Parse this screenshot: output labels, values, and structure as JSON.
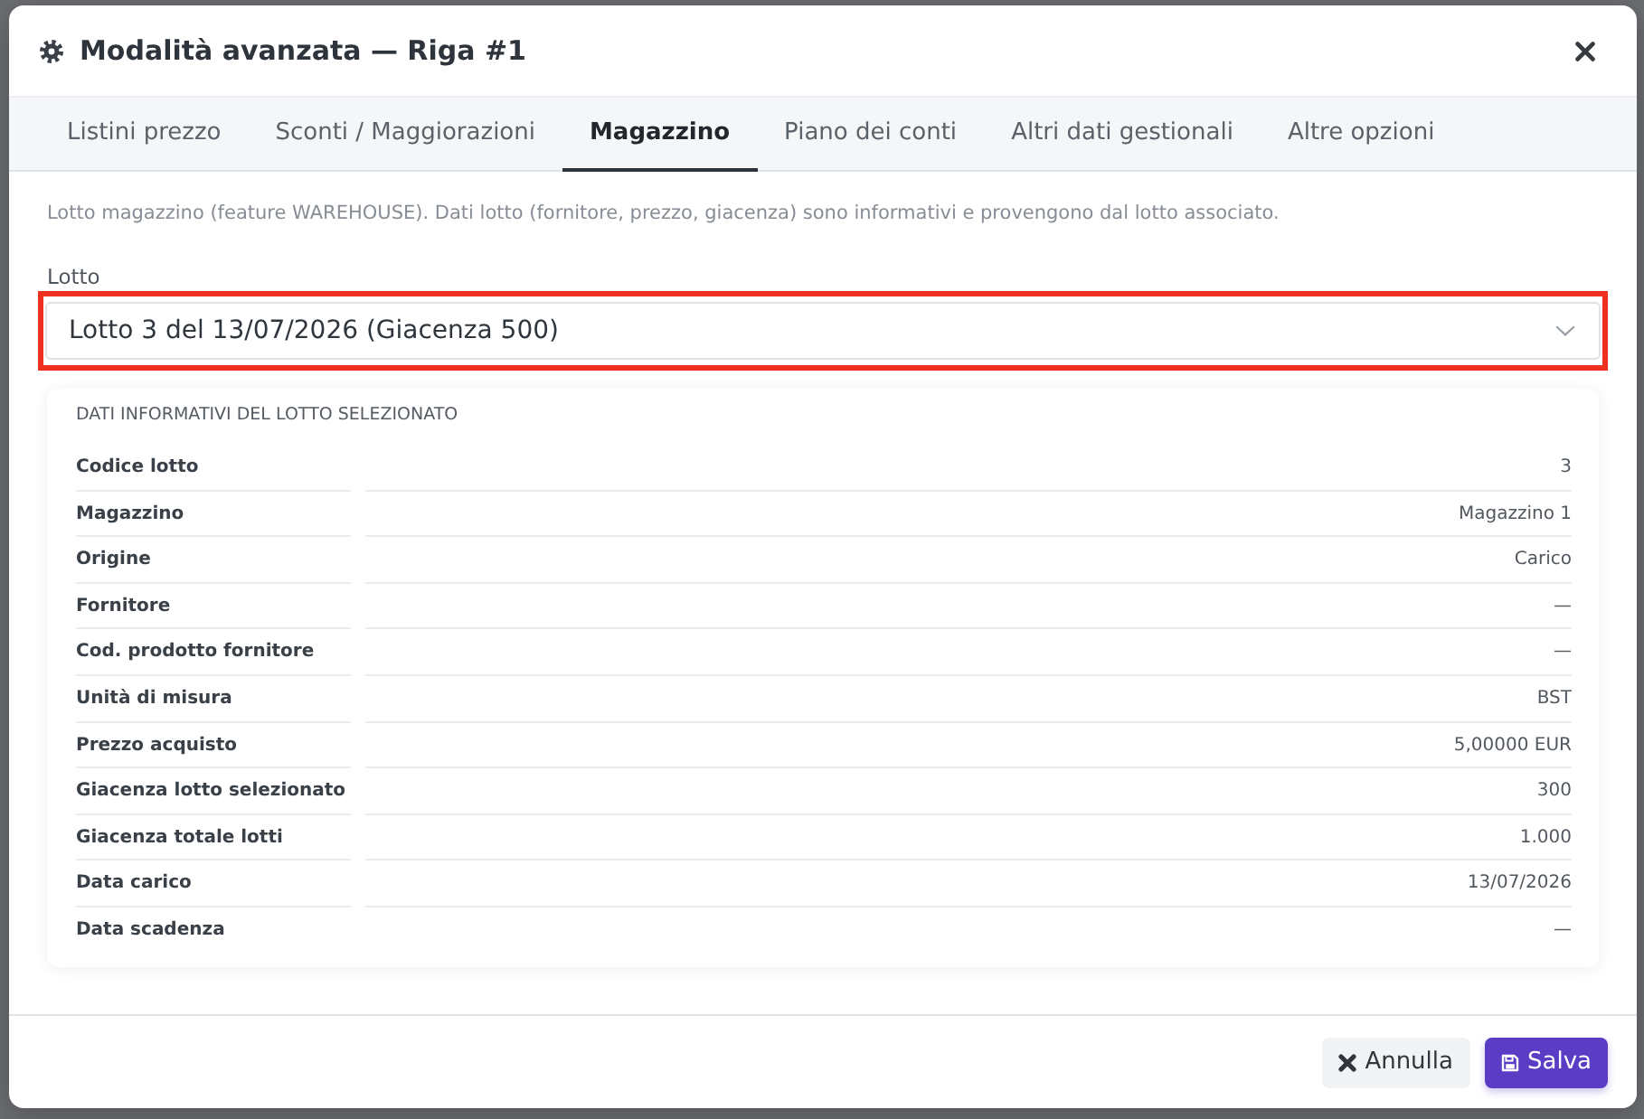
{
  "modal": {
    "title": "Modalità avanzata — Riga #1"
  },
  "tabs": [
    {
      "label": "Listini prezzo",
      "selected": false
    },
    {
      "label": "Sconti / Maggiorazioni",
      "selected": false
    },
    {
      "label": "Magazzino",
      "selected": true
    },
    {
      "label": "Piano dei conti",
      "selected": false
    },
    {
      "label": "Altri dati gestionali",
      "selected": false
    },
    {
      "label": "Altre opzioni",
      "selected": false
    }
  ],
  "description": "Lotto magazzino (feature WAREHOUSE). Dati lotto (fornitore, prezzo, giacenza) sono informativi e provengono dal lotto associato.",
  "lot_field": {
    "label": "Lotto",
    "value": "Lotto 3 del 13/07/2026 (Giacenza 500)",
    "highlighted": true
  },
  "lot_details": {
    "heading": "DATI INFORMATIVI DEL LOTTO SELEZIONATO",
    "rows": [
      {
        "label": "Codice lotto",
        "value": "3"
      },
      {
        "label": "Magazzino",
        "value": "Magazzino 1"
      },
      {
        "label": "Origine",
        "value": "Carico"
      },
      {
        "label": "Fornitore",
        "value": "—"
      },
      {
        "label": "Cod. prodotto fornitore",
        "value": "—"
      },
      {
        "label": "Unità di misura",
        "value": "BST"
      },
      {
        "label": "Prezzo acquisto",
        "value": "5,00000 EUR"
      },
      {
        "label": "Giacenza lotto selezionato",
        "value": "300"
      },
      {
        "label": "Giacenza totale lotti",
        "value": "1.000"
      },
      {
        "label": "Data carico",
        "value": "13/07/2026"
      },
      {
        "label": "Data scadenza",
        "value": "—"
      }
    ]
  },
  "buttons": [
    {
      "label": "Annulla",
      "kind": "secondary"
    },
    {
      "label": "Salva",
      "kind": "primary"
    }
  ]
}
